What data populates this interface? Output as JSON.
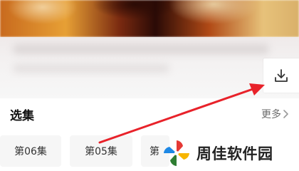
{
  "episodes_section": {
    "title": "选集",
    "more_label": "更多",
    "items": [
      {
        "label": "第06集"
      },
      {
        "label": "第05集"
      },
      {
        "label": "第"
      }
    ]
  },
  "watermark": {
    "text": "周佳软件园"
  },
  "icons": {
    "download": "download-icon",
    "more_chevron": "chevron-right-icon",
    "watermark_logo": "pinwheel-logo-icon"
  },
  "colors": {
    "arrow": "#e8222a",
    "text_primary": "#111111",
    "text_secondary": "#6b6b6b",
    "chip_background": "#f6f6f6"
  }
}
